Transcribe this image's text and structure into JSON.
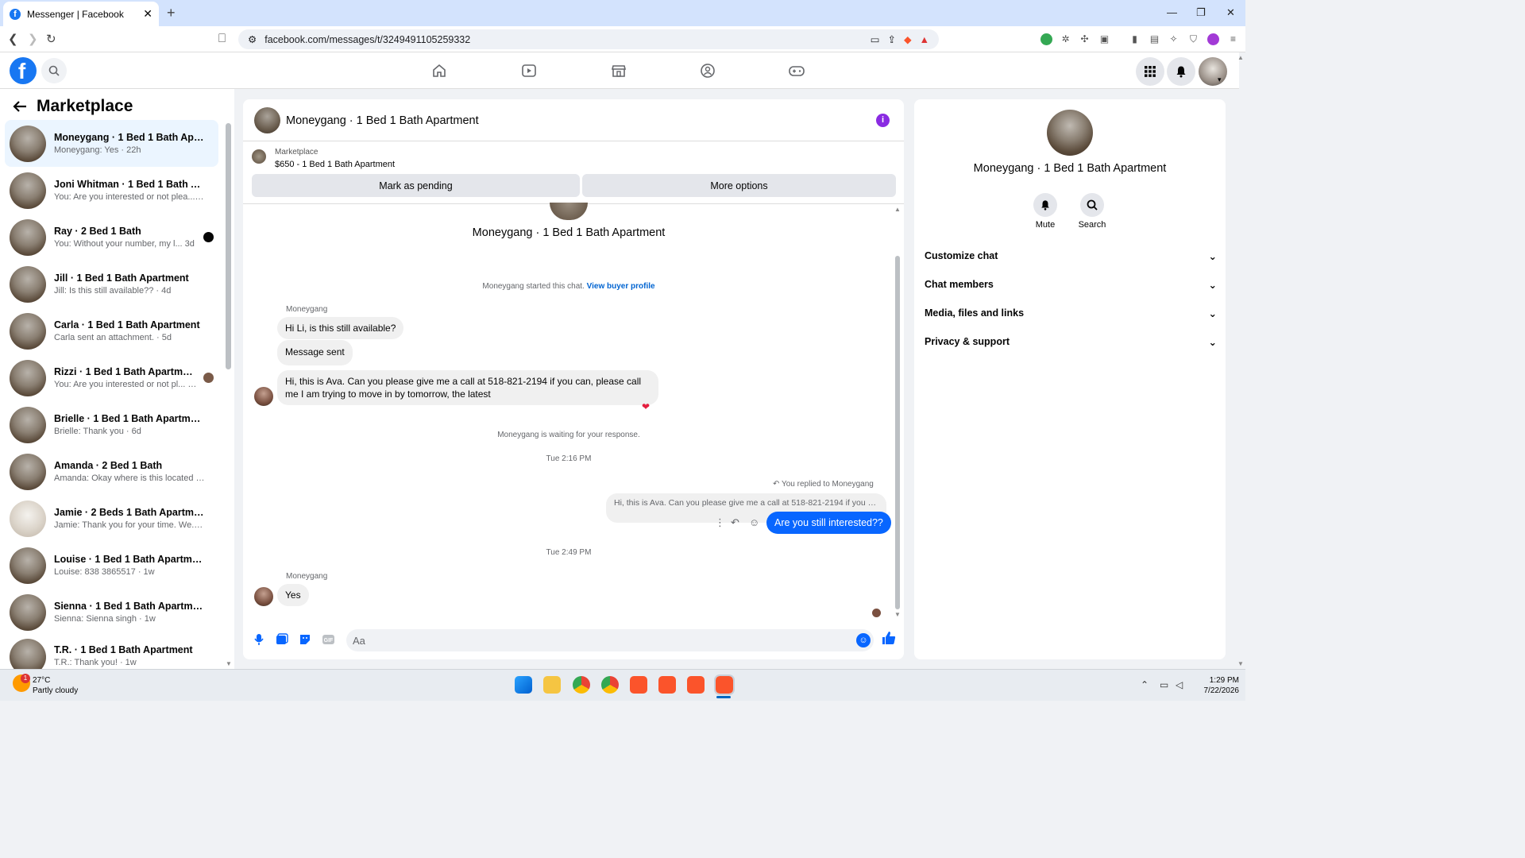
{
  "browser": {
    "tab_title": "Messenger | Facebook",
    "url": "facebook.com/messages/t/3249491105259332"
  },
  "leftpanel": {
    "title": "Marketplace",
    "conversations": [
      {
        "name": "Moneygang · 1 Bed 1 Bath Apart...",
        "preview": "Moneygang: Yes · 22h",
        "active": true
      },
      {
        "name": "Joni Whitman · 1 Bed 1 Bath Apa...",
        "preview": "You: Are you interested or not plea... · 2d"
      },
      {
        "name": "Ray · 2 Bed 1 Bath",
        "preview": "You: Without your number, my l...  3d",
        "unread": true
      },
      {
        "name": "Jill · 1 Bed 1 Bath Apartment",
        "preview": "Jill: Is this still available?? · 4d"
      },
      {
        "name": "Carla · 1 Bed 1 Bath Apartment",
        "preview": "Carla sent an attachment. · 5d"
      },
      {
        "name": "Rizzi · 1 Bed 1 Bath Apartment",
        "preview": "You: Are you interested or not pl... · 5d",
        "seen": true
      },
      {
        "name": "Brielle · 1 Bed 1 Bath Apartment",
        "preview": "Brielle: Thank you · 6d"
      },
      {
        "name": "Amanda · 2 Bed 1 Bath",
        "preview": "Amanda: Okay where is this located · 1w"
      },
      {
        "name": "Jamie · 2 Beds 1 Bath Apartment",
        "preview": "Jamie: Thank you for your time. We... · 1w"
      },
      {
        "name": "Louise · 1 Bed 1 Bath Apartment",
        "preview": "Louise: 838 3865517 · 1w"
      },
      {
        "name": "Sienna · 1 Bed 1 Bath Apartment",
        "preview": "Sienna: Sienna singh · 1w"
      },
      {
        "name": "T.R. · 1 Bed 1 Bath Apartment",
        "preview": "T.R.: Thank you! · 1w"
      }
    ]
  },
  "chat": {
    "title": "Moneygang · 1 Bed 1 Bath Apartment",
    "marketplace_label": "Marketplace",
    "listing": "$650 - 1 Bed 1 Bath Apartment",
    "mark_pending": "Mark as pending",
    "more_options": "More options",
    "profile_name": "Moneygang · 1 Bed 1 Bath Apartment",
    "started_text": "Moneygang started this chat.",
    "view_buyer_profile": "View buyer profile",
    "sender1": "Moneygang",
    "msg1": "Hi Li, is this still available?",
    "msg2": "Message sent",
    "msg3": "Hi, this is Ava. Can you please give me a call at 518-821-2194 if you can, please call me I am trying to move in by tomorrow, the latest",
    "waiting": "Moneygang is waiting for your response.",
    "time1": "Tue 2:16 PM",
    "replied_to": "You replied to Moneygang",
    "quoted": "Hi, this is Ava. Can you please give me a call at 518-821-2194 if you ca...",
    "out_msg": "Are you still interested??",
    "time2": "Tue 2:49 PM",
    "sender2": "Moneygang",
    "msg4": "Yes",
    "composer_placeholder": "Aa"
  },
  "rightpanel": {
    "name": "Moneygang · 1 Bed 1 Bath Apartment",
    "mute": "Mute",
    "search": "Search",
    "sections": [
      "Customize chat",
      "Chat members",
      "Media, files and links",
      "Privacy & support"
    ]
  },
  "taskbar": {
    "temp": "27°C",
    "weather": "Partly cloudy",
    "weather_badge": "1",
    "time": "1:29 PM",
    "date": "7/22/2026"
  }
}
